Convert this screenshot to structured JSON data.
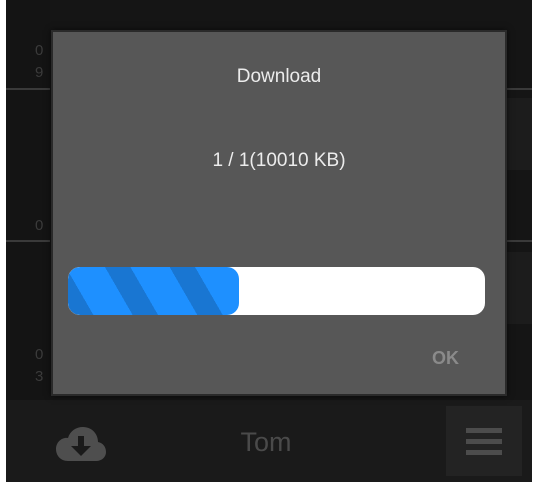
{
  "background": {
    "left_numbers": [
      "0",
      "9",
      "0",
      "0",
      "3"
    ],
    "username": "Tom",
    "icons": {
      "download": "cloud-download-icon",
      "menu": "hamburger-menu-icon"
    }
  },
  "dialog": {
    "title": "Download",
    "message": "1 / 1(10010 KB)",
    "progress_fraction": 0.41,
    "ok_label": "OK"
  },
  "colors": {
    "dialog_bg": "#575757",
    "progress_dark": "#1976d2",
    "progress_light": "#1e90ff",
    "ok_text": "#8a8a8a"
  }
}
